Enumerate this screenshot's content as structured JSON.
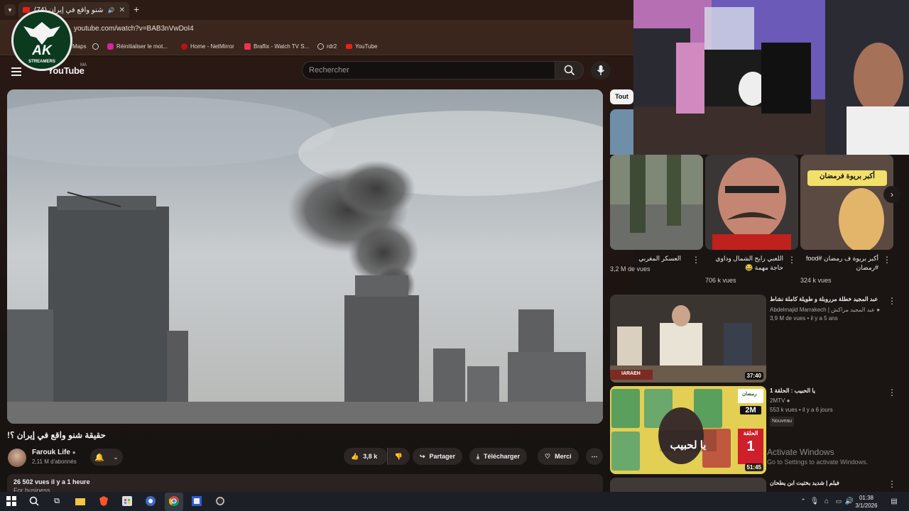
{
  "browser": {
    "tab_title": "(74) حقيقة شنو واقع في إيران",
    "url": "youtube.com/watch?v=BAB3nVwDoI4",
    "bookmarks": [
      {
        "label": "Maps",
        "icon": "maps-icon"
      },
      {
        "label": "",
        "icon": "globe-icon"
      },
      {
        "label": "Réinitialiser le mot...",
        "icon": "instagram-icon"
      },
      {
        "label": "Home - NetMirror",
        "icon": "netmirror-icon"
      },
      {
        "label": "Braflix - Watch TV S...",
        "icon": "braflix-icon"
      },
      {
        "label": "rdr2",
        "icon": "globe-icon"
      },
      {
        "label": "YouTube",
        "icon": "youtube-icon"
      }
    ]
  },
  "youtube": {
    "logo": "YouTube",
    "region": "MA",
    "search_placeholder": "Rechercher",
    "video": {
      "title": "حقيقة شنو واقع في إيران ؟!",
      "channel": "Farouk Life",
      "subscribers": "2,11 M d'abonnés",
      "likes": "3,8 k",
      "share": "Partager",
      "download": "Télécharger",
      "thanks": "Merci",
      "views_date": "26 502 vues  il y a 1 heure",
      "desc_preview": "For business"
    },
    "sidebar": {
      "chip_all": "Tout",
      "shorts": [
        {
          "title": "العسكر المغربي",
          "views": "3,2 M de vues"
        },
        {
          "title": "اللعبي رايح الشمال وداوي حاجة مهمة 😂",
          "views": "706 k vues"
        },
        {
          "title": "أكبر بريوة ف رمضان #food #رمضان",
          "views": "324 k vues"
        }
      ],
      "videos": [
        {
          "title": "عبد المجيد خطلة مرروبلة و طويلة كاملة نشاط",
          "channel": "Abdelmajid Marrakech | عبد المجيد مراكش",
          "meta": "3,9 M de vues • il y a 5 ans",
          "duration": "37:40",
          "badge": ""
        },
        {
          "title": "يا الحبيب : الحلقة 1",
          "channel": "2MTV",
          "meta": "553 k vues • il y a 6 jours",
          "duration": "51:45",
          "badge": "Nouveau"
        },
        {
          "title": "فيلم | شديد بختيت ابن يطحان",
          "channel": "",
          "meta": "",
          "duration": "",
          "badge": ""
        }
      ]
    }
  },
  "thumb_text": {
    "short3_caption": "أكبر بريوة فرمضان",
    "video1_tag": "IARAEH",
    "video2_ramadan": "رمضان",
    "video2_channel": "2M",
    "video2_episode_label": "الحلقة",
    "video2_episode_num": "1",
    "video2_show": "يا لحبيب"
  },
  "overlay": {
    "logo_text": "AK",
    "logo_sub": "STREAMERS"
  },
  "windows": {
    "activate_title": "Activate Windows",
    "activate_sub": "Go to Settings to activate Windows.",
    "time": "01:38",
    "date": "3/1/2026"
  },
  "colors": {
    "accent_red": "#e62117",
    "bg": "#161311"
  }
}
